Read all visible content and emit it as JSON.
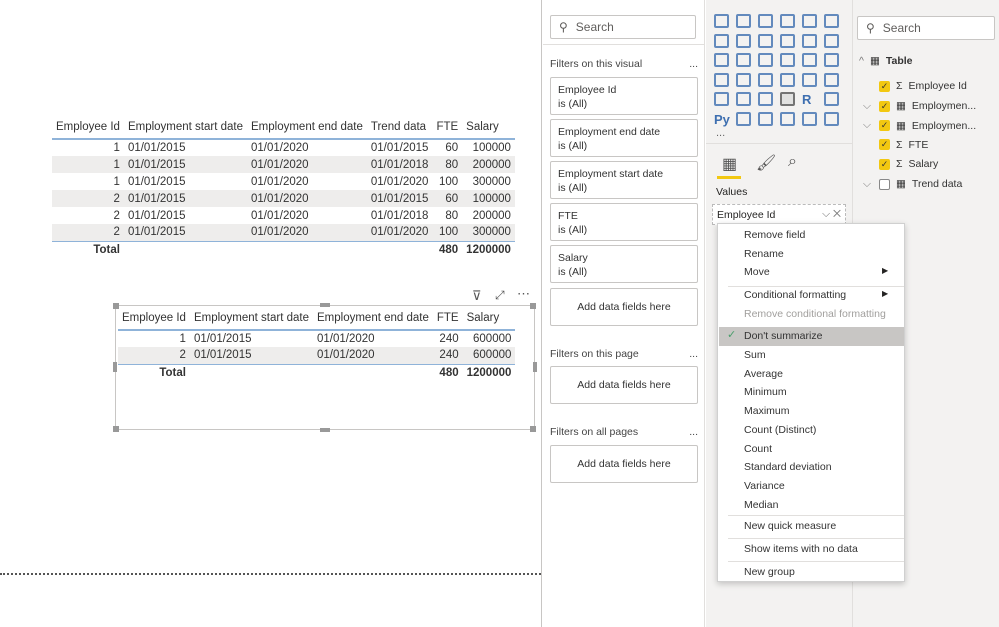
{
  "table1": {
    "headers": [
      "Employee Id",
      "Employment start date",
      "Employment end date",
      "Trend data",
      "FTE",
      "Salary"
    ],
    "rows": [
      [
        "1",
        "01/01/2015",
        "01/01/2020",
        "01/01/2015",
        "60",
        "100000"
      ],
      [
        "1",
        "01/01/2015",
        "01/01/2020",
        "01/01/2018",
        "80",
        "200000"
      ],
      [
        "1",
        "01/01/2015",
        "01/01/2020",
        "01/01/2020",
        "100",
        "300000"
      ],
      [
        "2",
        "01/01/2015",
        "01/01/2020",
        "01/01/2015",
        "60",
        "100000"
      ],
      [
        "2",
        "01/01/2015",
        "01/01/2020",
        "01/01/2018",
        "80",
        "200000"
      ],
      [
        "2",
        "01/01/2015",
        "01/01/2020",
        "01/01/2020",
        "100",
        "300000"
      ]
    ],
    "total": {
      "label": "Total",
      "fte": "480",
      "salary": "1200000"
    }
  },
  "table2": {
    "headers": [
      "Employee Id",
      "Employment start date",
      "Employment end date",
      "FTE",
      "Salary"
    ],
    "rows": [
      [
        "1",
        "01/01/2015",
        "01/01/2020",
        "240",
        "600000"
      ],
      [
        "2",
        "01/01/2015",
        "01/01/2020",
        "240",
        "600000"
      ]
    ],
    "total": {
      "label": "Total",
      "fte": "480",
      "salary": "1200000"
    }
  },
  "filters": {
    "search": "Search",
    "on_visual": "Filters on this visual",
    "cards": [
      {
        "name": "Employee Id",
        "state": "is (All)"
      },
      {
        "name": "Employment end date",
        "state": "is (All)"
      },
      {
        "name": "Employment start date",
        "state": "is (All)"
      },
      {
        "name": "FTE",
        "state": "is (All)"
      },
      {
        "name": "Salary",
        "state": "is (All)"
      }
    ],
    "add": "Add data fields here",
    "on_page": "Filters on this page",
    "all_pages": "Filters on all pages",
    "more": "..."
  },
  "viz": {
    "values_label": "Values",
    "field": "Employee Id",
    "r_label": "R",
    "py_label": "Py",
    "more": "..."
  },
  "fields": {
    "search": "Search",
    "table": "Table",
    "items": [
      {
        "name": "Employee Id",
        "icon": "sigma",
        "checked": true
      },
      {
        "name": "Employmen...",
        "icon": "calendar",
        "checked": true
      },
      {
        "name": "Employmen...",
        "icon": "calendar",
        "checked": true
      },
      {
        "name": "FTE",
        "icon": "sigma",
        "checked": true
      },
      {
        "name": "Salary",
        "icon": "sigma",
        "checked": true
      },
      {
        "name": "Trend data",
        "icon": "calendar",
        "checked": false
      }
    ]
  },
  "menu": {
    "remove": "Remove field",
    "rename": "Rename",
    "move": "Move",
    "cond": "Conditional formatting",
    "remove_cond": "Remove conditional formatting",
    "dont": "Don't summarize",
    "aggs": [
      "Sum",
      "Average",
      "Minimum",
      "Maximum",
      "Count (Distinct)",
      "Count",
      "Standard deviation",
      "Variance",
      "Median"
    ],
    "quick": "New quick measure",
    "show": "Show items with no data",
    "group": "New group"
  },
  "colors": {
    "accent": "#f2c811",
    "table_line": "#8fb3d9",
    "selected": "#c8c6c4"
  }
}
